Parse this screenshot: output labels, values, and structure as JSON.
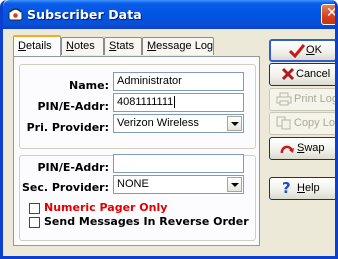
{
  "window": {
    "title": "Subscriber Data"
  },
  "tabs": [
    {
      "label": "Details",
      "hotkey": "D",
      "rest": "etails"
    },
    {
      "label": "Notes",
      "hotkey": "N",
      "rest": "otes"
    },
    {
      "label": "Stats",
      "hotkey": "S",
      "rest": "tats"
    },
    {
      "label": "Message Log",
      "hotkey": "M",
      "rest": "essage Log"
    }
  ],
  "form": {
    "name_label": "Name:",
    "name_value": "Administrator",
    "pin1_label": "PIN/E-Addr:",
    "pin1_value": "4081111111",
    "pri_provider_label": "Pri. Provider:",
    "pri_provider_value": "Verizon Wireless",
    "pin2_label": "PIN/E-Addr:",
    "pin2_value": "",
    "sec_provider_label": "Sec. Provider:",
    "sec_provider_value": "NONE",
    "numeric_pager_label": "Numeric Pager Only",
    "numeric_pager_checked": false,
    "reverse_order_label": "Send Messages In Reverse Order",
    "reverse_order_checked": false
  },
  "buttons": {
    "ok": {
      "hotkey": "O",
      "rest": "K",
      "icon": "checkmark-icon"
    },
    "cancel": {
      "label": "Cancel",
      "icon": "x-icon"
    },
    "print_log": {
      "label": "Print Log",
      "icon": "printer-icon",
      "disabled": true
    },
    "copy_log": {
      "label": "Copy Log",
      "icon": "copy-icon",
      "disabled": true
    },
    "swap": {
      "hotkey": "S",
      "rest": "wap",
      "icon": "swap-arrows-icon"
    },
    "help": {
      "hotkey": "H",
      "rest": "elp",
      "icon": "question-icon"
    }
  },
  "colors": {
    "titlebar": "#0054e3",
    "numeric_pager_label": "#e00000",
    "default_button_border": "#2f5fcf"
  }
}
